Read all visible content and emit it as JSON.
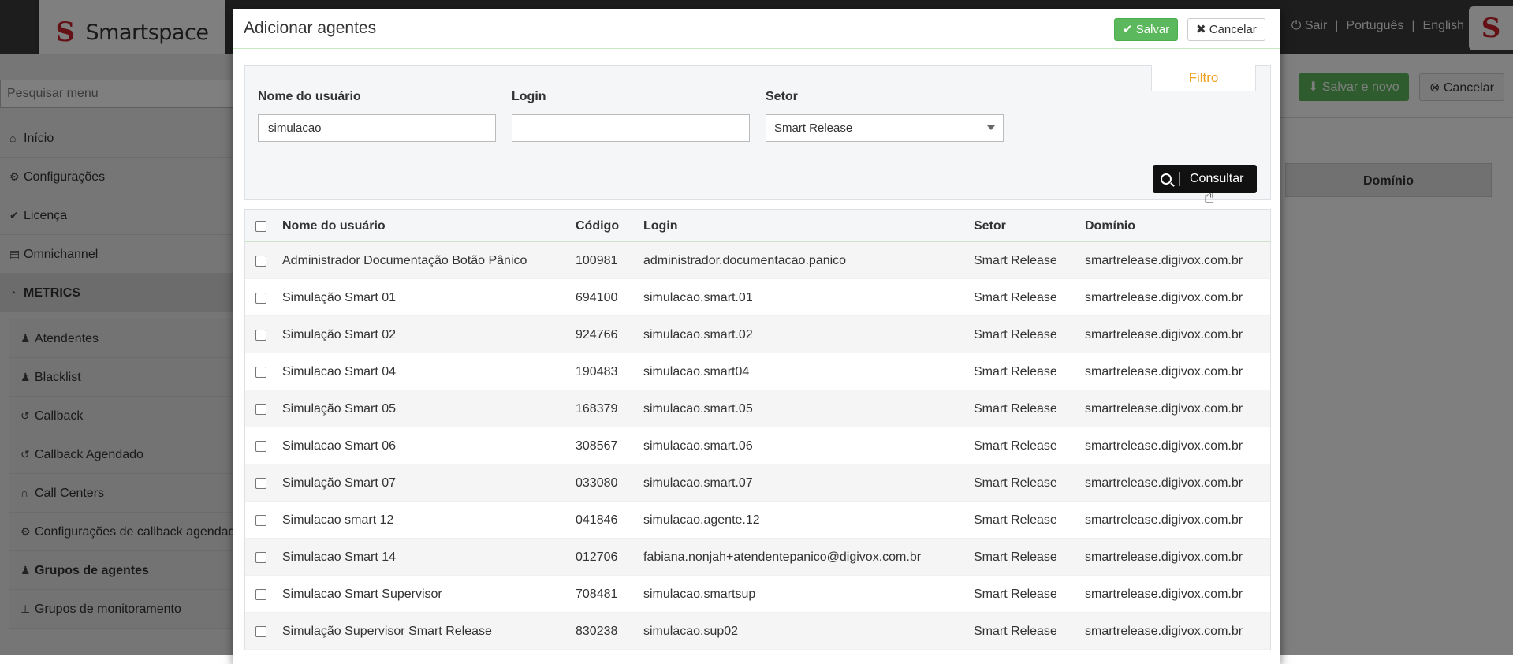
{
  "app": {
    "logo_text": "Smartspace",
    "logo_mark": "S",
    "logout_label": "Sair",
    "separator": "|",
    "lang_pt": "Português",
    "lang_en": "English",
    "avatar_mark": "S"
  },
  "sidebar": {
    "search_placeholder": "Pesquisar menu",
    "items": [
      {
        "label": "Início",
        "icon": "home-icon"
      },
      {
        "label": "Configurações",
        "icon": "cogs-icon"
      },
      {
        "label": "Licença",
        "icon": "check-circle-icon"
      },
      {
        "label": "Omnichannel",
        "icon": "file-icon"
      },
      {
        "label": "METRICS",
        "icon": "dashboard-icon"
      },
      {
        "label": "Atendentes",
        "icon": "user-icon"
      },
      {
        "label": "Blacklist",
        "icon": "user-times-icon"
      },
      {
        "label": "Callback",
        "icon": "history-icon"
      },
      {
        "label": "Callback Agendado",
        "icon": "history-icon"
      },
      {
        "label": "Call Centers",
        "icon": "headset-icon"
      },
      {
        "label": "Configurações de callback agendado",
        "icon": "cogs-icon"
      },
      {
        "label": "Grupos de agentes",
        "icon": "users-icon"
      },
      {
        "label": "Grupos de monitoramento",
        "icon": "sitemap-icon"
      }
    ]
  },
  "background": {
    "save_new_label": "Salvar e novo",
    "cancel_label": "Cancelar",
    "domain_header": "Domínio"
  },
  "modal": {
    "title": "Adicionar agentes",
    "save_label": "Salvar",
    "cancel_label": "Cancelar",
    "filter": {
      "tab_label": "Filtro",
      "username_label": "Nome do usuário",
      "username_value": "simulacao",
      "login_label": "Login",
      "login_value": "",
      "sector_label": "Setor",
      "sector_value": "Smart Release",
      "query_label": "Consultar"
    },
    "table": {
      "headers": {
        "name": "Nome do usuário",
        "code": "Código",
        "login": "Login",
        "sector": "Setor",
        "domain": "Domínio"
      },
      "rows": [
        {
          "name": "Administrador Documentação Botão Pânico",
          "code": "100981",
          "login": "administrador.documentacao.panico",
          "sector": "Smart Release",
          "domain": "smartrelease.digivox.com.br"
        },
        {
          "name": "Simulação Smart 01",
          "code": "694100",
          "login": "simulacao.smart.01",
          "sector": "Smart Release",
          "domain": "smartrelease.digivox.com.br"
        },
        {
          "name": "Simulação Smart 02",
          "code": "924766",
          "login": "simulacao.smart.02",
          "sector": "Smart Release",
          "domain": "smartrelease.digivox.com.br"
        },
        {
          "name": "Simulacao Smart 04",
          "code": "190483",
          "login": "simulacao.smart04",
          "sector": "Smart Release",
          "domain": "smartrelease.digivox.com.br"
        },
        {
          "name": "Simulação Smart 05",
          "code": "168379",
          "login": "simulacao.smart.05",
          "sector": "Smart Release",
          "domain": "smartrelease.digivox.com.br"
        },
        {
          "name": "Simulacao Smart 06",
          "code": "308567",
          "login": "simulacao.smart.06",
          "sector": "Smart Release",
          "domain": "smartrelease.digivox.com.br"
        },
        {
          "name": "Simulação Smart 07",
          "code": "033080",
          "login": "simulacao.smart.07",
          "sector": "Smart Release",
          "domain": "smartrelease.digivox.com.br"
        },
        {
          "name": "Simulacao smart 12",
          "code": "041846",
          "login": "simulacao.agente.12",
          "sector": "Smart Release",
          "domain": "smartrelease.digivox.com.br"
        },
        {
          "name": "Simulacao Smart 14",
          "code": "012706",
          "login": "fabiana.nonjah+atendentepanico@digivox.com.br",
          "sector": "Smart Release",
          "domain": "smartrelease.digivox.com.br"
        },
        {
          "name": "Simulacao Smart Supervisor",
          "code": "708481",
          "login": "simulacao.smartsup",
          "sector": "Smart Release",
          "domain": "smartrelease.digivox.com.br"
        },
        {
          "name": "Simulação Supervisor Smart Release",
          "code": "830238",
          "login": "simulacao.sup02",
          "sector": "Smart Release",
          "domain": "smartrelease.digivox.com.br"
        }
      ]
    }
  }
}
